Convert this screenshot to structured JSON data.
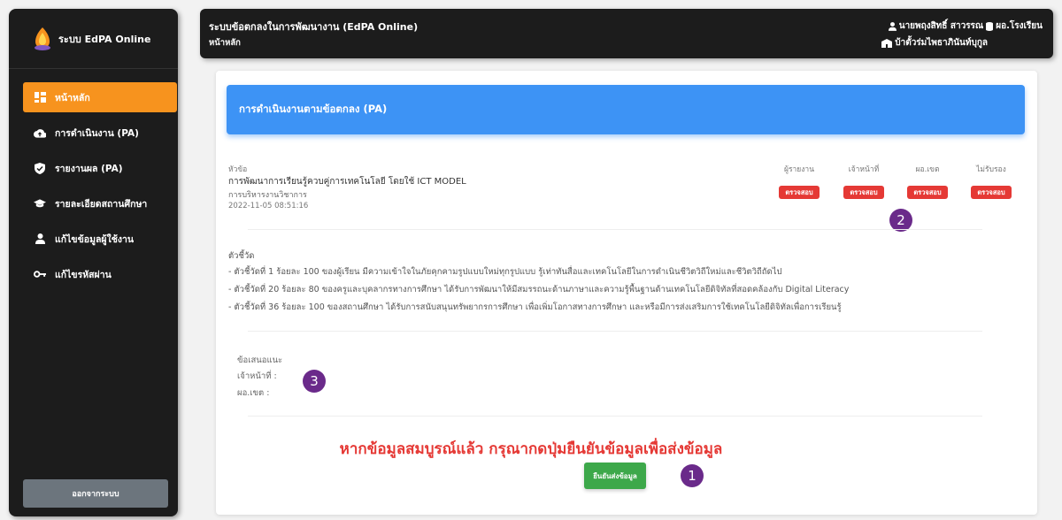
{
  "sidebar": {
    "brand": "ระบบ EdPA Online",
    "items": [
      {
        "label": "หน้าหลัก",
        "icon": "dashboard-icon"
      },
      {
        "label": "การดำเนินงาน (PA)",
        "icon": "cloud-upload-icon"
      },
      {
        "label": "รายงานผล (PA)",
        "icon": "shield-check-icon"
      },
      {
        "label": "รายละเอียดสถานศึกษา",
        "icon": "graduation-cap-icon"
      },
      {
        "label": "แก้ไขข้อมูลผู้ใช้งาน",
        "icon": "user-icon"
      },
      {
        "label": "แก้ไขรหัสผ่าน",
        "icon": "key-icon"
      }
    ],
    "logout": "ออกจากระบบ"
  },
  "topbar": {
    "title": "ระบบข้อตกลงในการพัฒนางาน (EdPA Online)",
    "subtitle": "หน้าหลัก",
    "user_name": "นายพฤงสิทธิ์ สาวรรณ",
    "role": "ผอ.โรงเรียน",
    "school": "บ้าตั้วร่มไพธาภินันท์บุกูล"
  },
  "card": {
    "header": "การดำเนินงานตามข้อตกลง (PA)",
    "topic_label": "หัวข้อ",
    "topic_title": "การพัฒนาการเรียนรู้ควบคู่การเทคโนโลยี โดยใช้ ICT MODEL",
    "topic_area": "การบริหารงานวิชาการ",
    "topic_date": "2022-11-05 08:51:16",
    "status_columns": [
      "ผู้รายงาน",
      "เจ้าหน้าที่",
      "ผอ.เขต",
      "ไม่รับรอง"
    ],
    "status_badge": "ตรวจสอบ",
    "indicators_label": "ตัวชี้วัด",
    "indicators": [
      "- ตัวชี้วัดที่ 1 ร้อยละ 100 ของผู้เรียน มีความเข้าใจในภัยคุกคามรูปแบบใหม่ทุกรูปแบบ รู้เท่าทันสื่อและเทคโนโลยีในการดำเนินชีวิตวิถีใหม่และชีวิตวิถีถัดไป",
      "- ตัวชี้วัดที่ 20 ร้อยละ 80 ของครูและบุคลากรทางการศึกษา ได้รับการพัฒนาให้มีสมรรถนะด้านภาษาและความรู้พื้นฐานด้านเทคโนโลยีดิจิทัลที่สอดคล้องกับ Digital Literacy",
      "- ตัวชี้วัดที่ 36 ร้อยละ 100 ของสถานศึกษา ได้รับการสนับสนุนทรัพยากรการศึกษา เพื่อเพิ่มโอกาสทางการศึกษา และหรือมีการส่งเสริมการใช้เทคโนโลยีดิจิทัลเพื่อการเรียนรู้"
    ],
    "suggest_label": "ข้อเสนอแนะ",
    "suggest_officer": "เจ้าหน้าที่ :",
    "suggest_director": "ผอ.เขต :",
    "warning": "หากข้อมูลสมบูรณ์แล้ว กรุณากดปุ่มยืนยันข้อมูลเพื่อส่งข้อมูล",
    "confirm_button": "ยืนยันส่งข้อมูล"
  },
  "markers": [
    "1",
    "2",
    "3"
  ],
  "colors": {
    "accent": "#f7931e",
    "header_blue": "#3d93f5",
    "danger": "#e53935",
    "success": "#3da84a",
    "marker": "#6a2a8a"
  }
}
